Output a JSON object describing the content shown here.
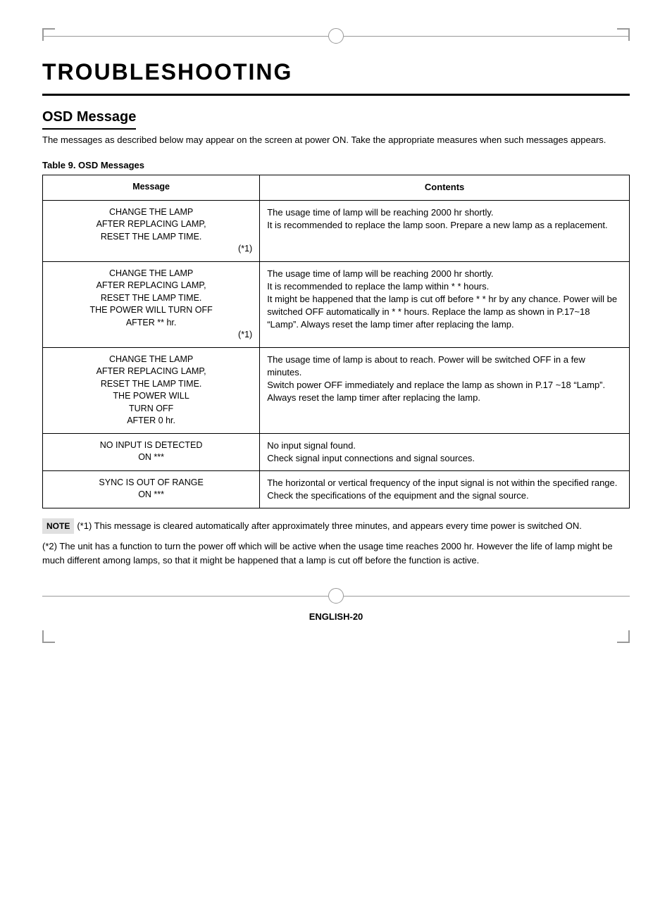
{
  "page": {
    "main_title": "TROUBLESHOOTING",
    "section_title": "OSD Message",
    "intro_text": "The messages as described below may appear on the screen at power ON. Take the appropriate measures when such messages appears.",
    "table_title": "Table 9. OSD Messages",
    "table_headers": {
      "col1": "Message",
      "col2": "Contents"
    },
    "table_rows": [
      {
        "message": "CHANGE THE LAMP\nAFTER REPLACING LAMP,\nRESET THE LAMP TIME.\n(*1)",
        "contents": "The usage time of lamp will be reaching 2000 hr shortly.\nIt is recommended to replace the lamp soon.  Prepare a new lamp as a replacement."
      },
      {
        "message": "CHANGE THE LAMP\nAFTER REPLACING LAMP,\nRESET THE LAMP TIME.\nTHE POWER WILL TURN OFF\nAFTER ** hr.\n(*1)",
        "contents": "The usage time of lamp will be reaching 2000 hr shortly.\nIt is recommended to replace the lamp within * * hours.\nIt might be happened that the lamp is cut off before * * hr by any chance.  Power will be switched OFF automatically in * * hours.  Replace the lamp as shown in P.17~18 “Lamp”.  Always reset the lamp timer after replacing the lamp."
      },
      {
        "message": "CHANGE THE LAMP\nAFTER REPLACING LAMP,\nRESET THE LAMP TIME.\nTHE POWER WILL\nTURN OFF\nAFTER 0 hr.",
        "contents": "The usage time of lamp is about to reach.  Power will be switched OFF in a few minutes.\nSwitch power OFF immediately and replace the lamp as shown in P.17 ~18 “Lamp”.  Always reset the lamp timer after replacing the lamp."
      },
      {
        "message": "NO INPUT IS DETECTED\nON ***",
        "contents": "No input signal found.\nCheck signal input connections and signal sources."
      },
      {
        "message": "SYNC IS OUT OF RANGE\nON ***",
        "contents": "The horizontal or vertical frequency of the input signal is not within the specified range.\nCheck the specifications of the equipment and the signal source."
      }
    ],
    "note_label": "NOTE",
    "note_text": "(*1) This message is cleared automatically after approximately three minutes, and appears every time power is switched ON.",
    "note2_text": "(*2) The unit has a function to turn the power off which will be active when the usage time reaches 2000 hr.  However the life of lamp might be much different among lamps, so that it might be happened that a lamp is cut off before the function is active.",
    "footer_text": "ENGLISH-20"
  }
}
